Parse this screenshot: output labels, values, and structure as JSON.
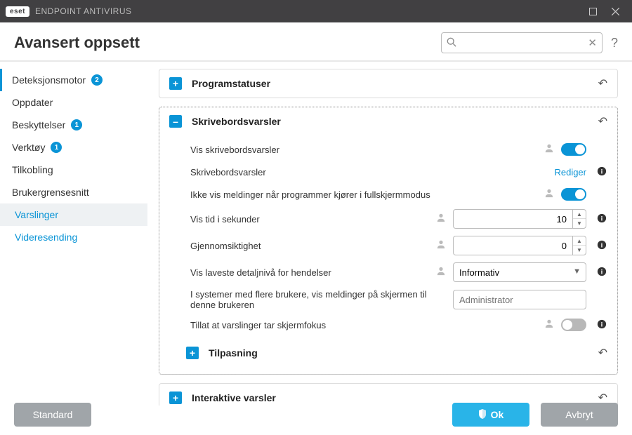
{
  "titlebar": {
    "brand_logo": "eset",
    "brand_text": "ENDPOINT ANTIVIRUS"
  },
  "header": {
    "title": "Avansert oppsett",
    "search_placeholder": ""
  },
  "sidebar": {
    "items": [
      {
        "label": "Deteksjonsmotor",
        "badge": "2"
      },
      {
        "label": "Oppdater",
        "badge": null
      },
      {
        "label": "Beskyttelser",
        "badge": "1"
      },
      {
        "label": "Verktøy",
        "badge": "1"
      },
      {
        "label": "Tilkobling",
        "badge": null
      },
      {
        "label": "Brukergrensesnitt",
        "badge": null
      }
    ],
    "subitems": [
      {
        "label": "Varslinger"
      },
      {
        "label": "Videresending"
      }
    ]
  },
  "panels": {
    "programstatuser": {
      "title": "Programstatuser"
    },
    "skrivebord": {
      "title": "Skrivebordsvarsler",
      "rows": {
        "vis_varsler": {
          "label": "Vis skrivebordsvarsler",
          "on": true
        },
        "rediger": {
          "label": "Skrivebordsvarsler",
          "link": "Rediger"
        },
        "fullscreen": {
          "label": "Ikke vis meldinger når programmer kjører i fullskjermmodus",
          "on": true
        },
        "vis_tid": {
          "label": "Vis tid i sekunder",
          "value": "10"
        },
        "gjennom": {
          "label": "Gjennomsiktighet",
          "value": "0"
        },
        "detaljniva": {
          "label": "Vis laveste detaljnivå for hendelser",
          "value": "Informativ"
        },
        "bruker": {
          "label": "I systemer med flere brukere, vis meldinger på skjermen til denne brukeren",
          "placeholder": "Administrator"
        },
        "fokus": {
          "label": "Tillat at varslinger tar skjermfokus",
          "on": false
        }
      },
      "tilpasning": {
        "title": "Tilpasning"
      }
    },
    "interaktive": {
      "title": "Interaktive varsler"
    }
  },
  "footer": {
    "standard": "Standard",
    "ok": "Ok",
    "cancel": "Avbryt"
  }
}
